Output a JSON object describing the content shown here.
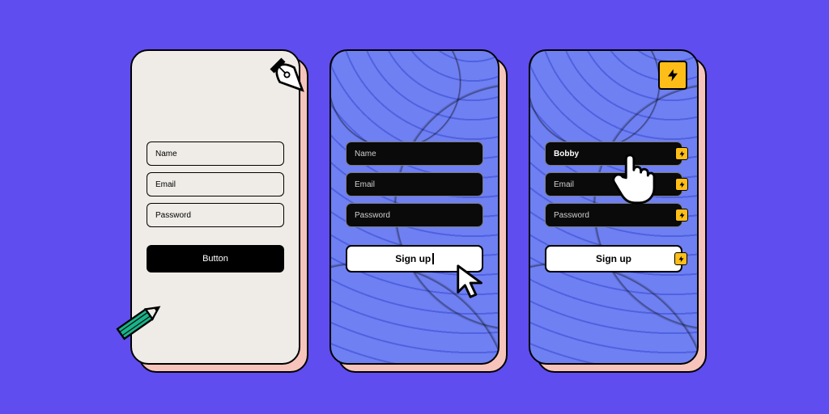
{
  "phones": {
    "wireframe": {
      "name_label": "Name",
      "email_label": "Email",
      "password_label": "Password",
      "button_label": "Button"
    },
    "styled": {
      "name_label": "Name",
      "email_label": "Email",
      "password_label": "Password",
      "button_label": "Sign up"
    },
    "interactive": {
      "name_value": "Bobby",
      "email_label": "Email",
      "password_label": "Password",
      "button_label": "Sign up"
    }
  },
  "icons": {
    "pen_nib": "pen-nib-icon",
    "pencil": "pencil-icon",
    "arrow_cursor": "arrow-cursor-icon",
    "hand_cursor": "hand-cursor-icon",
    "lightning": "lightning-icon"
  },
  "colors": {
    "canvas": "#5f4def",
    "shadow": "#f7c4bb",
    "accent": "#ffbe17",
    "marble": "#6e80f2"
  }
}
